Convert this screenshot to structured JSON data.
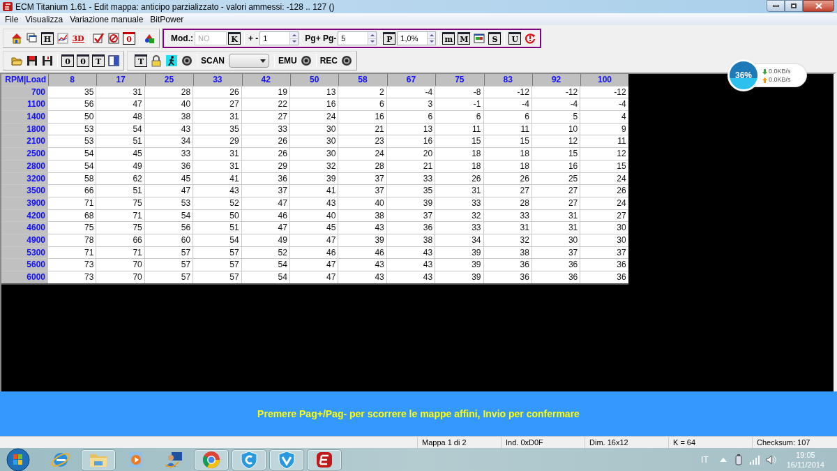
{
  "window": {
    "title": "ECM Titanium 1.61 - Edit mappa: anticipo parzializzato - valori ammessi: -128 .. 127 ()"
  },
  "menu": [
    "File",
    "Visualizza",
    "Variazione manuale",
    "BitPower"
  ],
  "toolbar_rows": [
    [
      {
        "framed": false,
        "items": [
          {
            "kind": "home"
          },
          {
            "kind": "windows"
          },
          {
            "kind": "letter",
            "label": "H"
          },
          {
            "kind": "chart"
          },
          {
            "kind": "letter3d",
            "label": "3D"
          },
          {
            "kind": "sep"
          },
          {
            "kind": "check"
          },
          {
            "kind": "forbid"
          },
          {
            "kind": "redletter",
            "label": "0"
          },
          {
            "kind": "sep"
          },
          {
            "kind": "shapes"
          }
        ]
      },
      {
        "framed": true,
        "items": [
          {
            "kind": "label",
            "label": "Mod.:"
          },
          {
            "kind": "field",
            "value": "NO",
            "disabled": true
          },
          {
            "kind": "letter",
            "label": "K"
          },
          {
            "kind": "sep"
          },
          {
            "kind": "label",
            "label": "+ -"
          },
          {
            "kind": "spin",
            "value": "1"
          },
          {
            "kind": "sep"
          },
          {
            "kind": "label",
            "label": "Pg+ Pg-"
          },
          {
            "kind": "spin",
            "value": "5"
          },
          {
            "kind": "sep"
          },
          {
            "kind": "letter",
            "label": "P"
          },
          {
            "kind": "spin",
            "value": "1,0%"
          },
          {
            "kind": "sep"
          },
          {
            "kind": "letter",
            "label": "m"
          },
          {
            "kind": "letter",
            "label": "M"
          },
          {
            "kind": "bars"
          },
          {
            "kind": "letter",
            "label": "S"
          },
          {
            "kind": "sep"
          },
          {
            "kind": "letter",
            "label": "U"
          },
          {
            "kind": "refresh"
          }
        ]
      }
    ],
    [
      {
        "framed": false,
        "items": [
          {
            "kind": "open"
          },
          {
            "kind": "savered"
          },
          {
            "kind": "save"
          },
          {
            "kind": "sep"
          },
          {
            "kind": "letter",
            "label": "0"
          },
          {
            "kind": "letter",
            "label": "0"
          },
          {
            "kind": "letter",
            "label": "T"
          },
          {
            "kind": "panel"
          }
        ]
      },
      {
        "framed": false,
        "items": [
          {
            "kind": "letter",
            "label": "T"
          },
          {
            "kind": "lock"
          },
          {
            "kind": "runner"
          },
          {
            "kind": "record"
          },
          {
            "kind": "sep"
          },
          {
            "kind": "label",
            "label": "SCAN"
          },
          {
            "kind": "dropdown"
          },
          {
            "kind": "sep"
          },
          {
            "kind": "label",
            "label": "EMU"
          },
          {
            "kind": "record"
          },
          {
            "kind": "sep"
          },
          {
            "kind": "label",
            "label": "REC"
          },
          {
            "kind": "record"
          }
        ]
      }
    ]
  ],
  "network_widget": {
    "percent": "36%",
    "download": "0.0KB/s",
    "upload": "0.0KB/s"
  },
  "table": {
    "corner": "RPM|Load",
    "columns": [
      "8",
      "17",
      "25",
      "33",
      "42",
      "50",
      "58",
      "67",
      "75",
      "83",
      "92",
      "100"
    ],
    "rows": [
      {
        "rpm": "700",
        "values": [
          "35",
          "31",
          "28",
          "26",
          "19",
          "13",
          "2",
          "-4",
          "-8",
          "-12",
          "-12",
          "-12"
        ]
      },
      {
        "rpm": "1100",
        "values": [
          "56",
          "47",
          "40",
          "27",
          "22",
          "16",
          "6",
          "3",
          "-1",
          "-4",
          "-4",
          "-4"
        ]
      },
      {
        "rpm": "1400",
        "values": [
          "50",
          "48",
          "38",
          "31",
          "27",
          "24",
          "16",
          "6",
          "6",
          "6",
          "5",
          "4"
        ]
      },
      {
        "rpm": "1800",
        "values": [
          "53",
          "54",
          "43",
          "35",
          "33",
          "30",
          "21",
          "13",
          "11",
          "11",
          "10",
          "9"
        ]
      },
      {
        "rpm": "2100",
        "values": [
          "53",
          "51",
          "34",
          "29",
          "26",
          "30",
          "23",
          "16",
          "15",
          "15",
          "12",
          "11"
        ]
      },
      {
        "rpm": "2500",
        "values": [
          "54",
          "45",
          "33",
          "31",
          "26",
          "30",
          "24",
          "20",
          "18",
          "18",
          "15",
          "12"
        ]
      },
      {
        "rpm": "2800",
        "values": [
          "54",
          "49",
          "36",
          "31",
          "29",
          "32",
          "28",
          "21",
          "18",
          "18",
          "16",
          "15"
        ]
      },
      {
        "rpm": "3200",
        "values": [
          "58",
          "62",
          "45",
          "41",
          "36",
          "39",
          "37",
          "33",
          "26",
          "26",
          "25",
          "24"
        ]
      },
      {
        "rpm": "3500",
        "values": [
          "66",
          "51",
          "47",
          "43",
          "37",
          "41",
          "37",
          "35",
          "31",
          "27",
          "27",
          "26"
        ]
      },
      {
        "rpm": "3900",
        "values": [
          "71",
          "75",
          "53",
          "52",
          "47",
          "43",
          "40",
          "39",
          "33",
          "28",
          "27",
          "24"
        ]
      },
      {
        "rpm": "4200",
        "values": [
          "68",
          "71",
          "54",
          "50",
          "46",
          "40",
          "38",
          "37",
          "32",
          "33",
          "31",
          "27"
        ]
      },
      {
        "rpm": "4600",
        "values": [
          "75",
          "75",
          "56",
          "51",
          "47",
          "45",
          "43",
          "36",
          "33",
          "31",
          "31",
          "30"
        ]
      },
      {
        "rpm": "4900",
        "values": [
          "78",
          "66",
          "60",
          "54",
          "49",
          "47",
          "39",
          "38",
          "34",
          "32",
          "30",
          "30"
        ]
      },
      {
        "rpm": "5300",
        "values": [
          "71",
          "71",
          "57",
          "57",
          "52",
          "46",
          "46",
          "43",
          "39",
          "38",
          "37",
          "37"
        ]
      },
      {
        "rpm": "5600",
        "values": [
          "73",
          "70",
          "57",
          "57",
          "54",
          "47",
          "43",
          "43",
          "39",
          "36",
          "36",
          "36"
        ]
      },
      {
        "rpm": "6000",
        "values": [
          "73",
          "70",
          "57",
          "57",
          "54",
          "47",
          "43",
          "43",
          "39",
          "36",
          "36",
          "36"
        ]
      }
    ]
  },
  "message": "Premere Pag+/Pag- per scorrere le mappe affini, Invio per confermare",
  "status_bar": [
    "Mappa 1 di 2",
    "Ind. 0xD0F",
    "Dim. 16x12",
    "K = 64",
    "Checksum: 107"
  ],
  "taskbar": {
    "apps": [
      {
        "kind": "start",
        "running": false
      },
      {
        "kind": "browser",
        "running": false
      },
      {
        "kind": "folder",
        "running": true
      },
      {
        "kind": "media",
        "running": false
      },
      {
        "kind": "user",
        "running": false
      },
      {
        "kind": "chrome",
        "running": true
      },
      {
        "kind": "shieldc",
        "running": true
      },
      {
        "kind": "shieldv",
        "running": true
      },
      {
        "kind": "ecm",
        "running": true
      }
    ],
    "language": "IT",
    "time": "19:05",
    "date": "16/11/2014"
  }
}
